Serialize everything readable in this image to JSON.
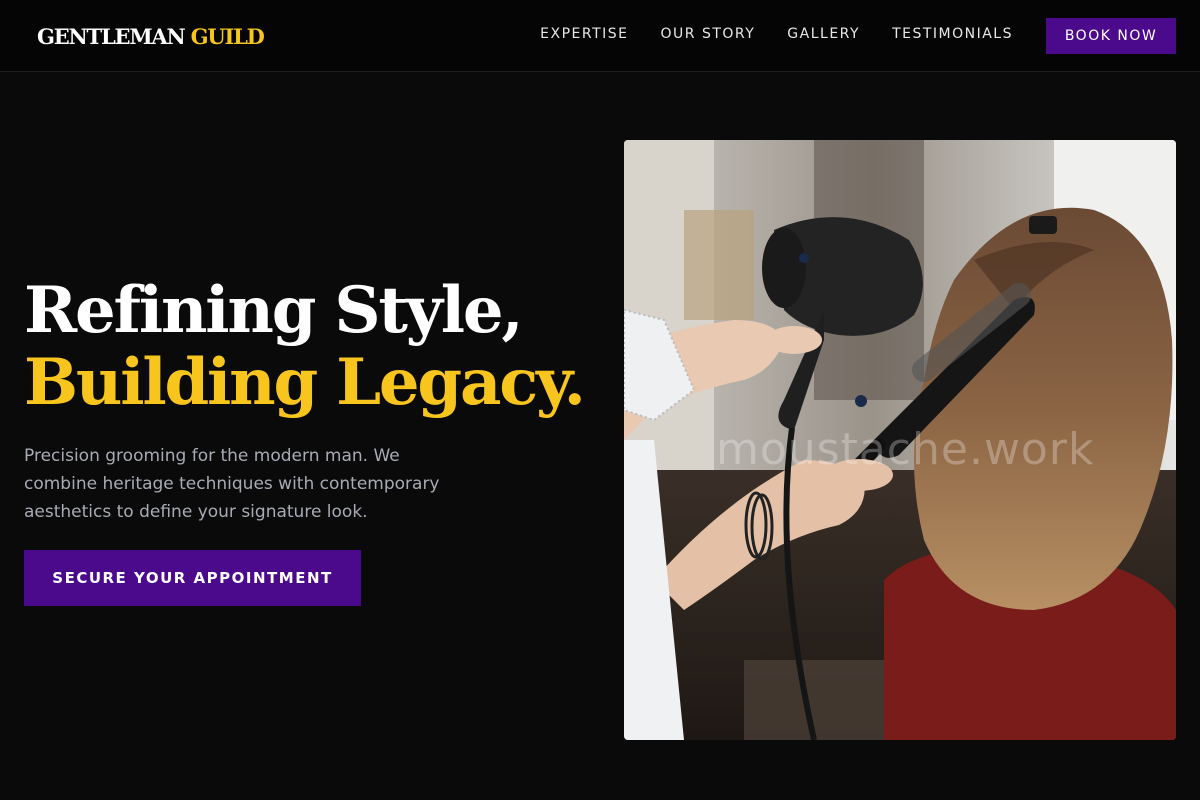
{
  "brand": {
    "logo_main": "GENTLEMAN",
    "logo_accent": "GUILD",
    "accent_color": "#f7c51d",
    "primary_color": "#4b0a8c"
  },
  "nav": {
    "links": [
      {
        "label": "EXPERTISE"
      },
      {
        "label": "OUR STORY"
      },
      {
        "label": "GALLERY"
      },
      {
        "label": "TESTIMONIALS"
      }
    ],
    "cta_label": "BOOK NOW"
  },
  "hero": {
    "title_line1": "Refining Style,",
    "title_line2": "Building Legacy.",
    "description": "Precision grooming for the modern man. We combine heritage techniques with contemporary aesthetics to define your signature look.",
    "cta_label": "SECURE YOUR APPOINTMENT",
    "image": {
      "subject": "stylist blow-drying client's hair with round brush",
      "watermark": "moustache.work"
    }
  }
}
